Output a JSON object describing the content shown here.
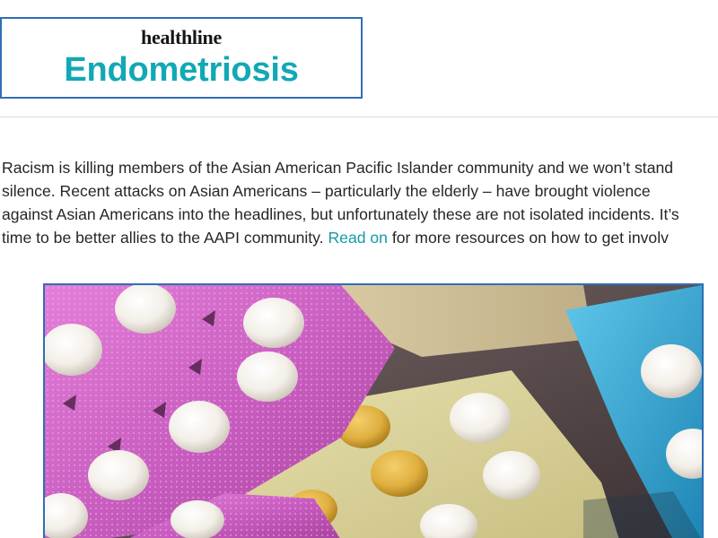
{
  "header": {
    "brand": "healthline",
    "title": "Endometriosis"
  },
  "intro": {
    "line1": "Racism is killing members of the Asian American Pacific Islander community and we won’t stand",
    "line2": "silence. Recent attacks on Asian Americans – particularly the elderly – have brought violence",
    "line3": "against Asian Americans into the headlines, but unfortunately these are not isolated incidents. It’s",
    "line4_before": "time to be better allies to the AAPI community. ",
    "link_label": "Read on",
    "line4_after": " for more resources on how to get involv"
  },
  "hero_image": {
    "description_icon": "pill-blister-packs-image"
  },
  "colors": {
    "accent_teal": "#12a8b5",
    "link_teal": "#159aa6",
    "border_blue": "#2f6fb5",
    "text": "#262626"
  }
}
